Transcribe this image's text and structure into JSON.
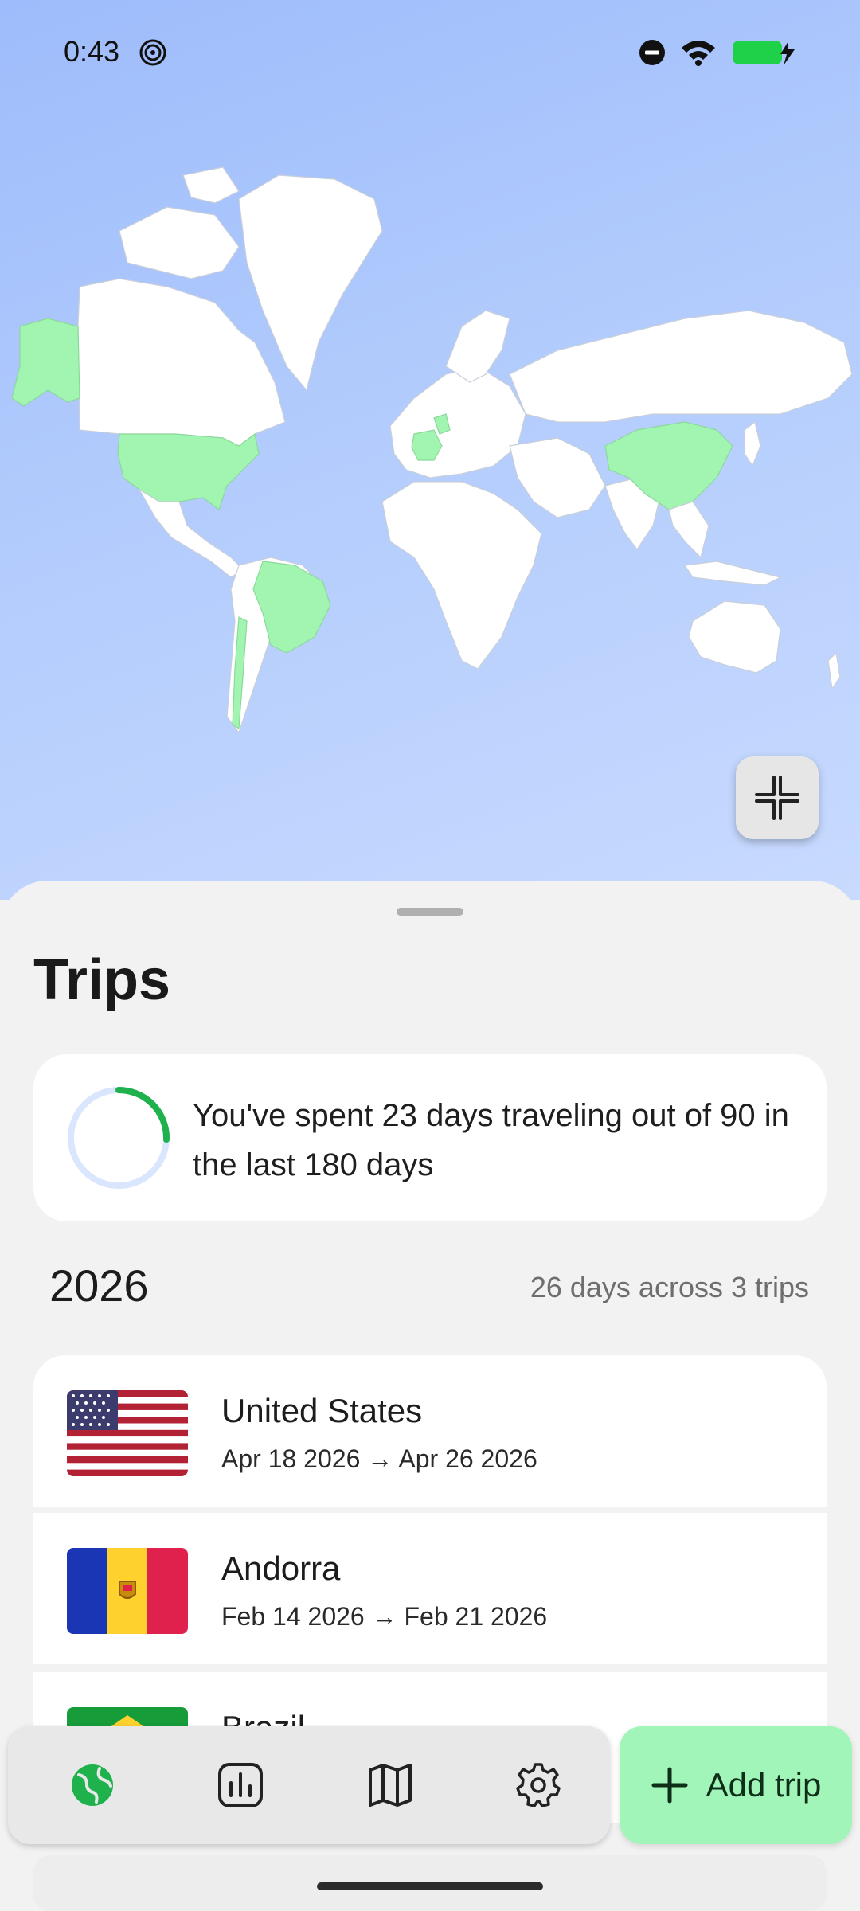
{
  "status_bar": {
    "time": "0:43",
    "left_icon": "spiral-notification-icon",
    "right_icons": [
      "do-not-disturb-icon",
      "wifi-icon",
      "battery-charging-icon"
    ]
  },
  "map": {
    "visited_color": "#a1f5b0",
    "land_color": "#ffffff",
    "ocean_color": "#a9c4fc",
    "collapse_icon": "collapse-icon"
  },
  "sheet": {
    "title": "Trips",
    "summary": {
      "text": "You've spent 23 days traveling out of 90 in the last 180 days",
      "days_spent": 23,
      "days_allowed": 90,
      "progress_fraction": 0.2556
    },
    "year_group": {
      "year": "2026",
      "stats": "26 days across 3 trips"
    },
    "trips": [
      {
        "country": "United States",
        "start": "Apr 18 2026",
        "end": "Apr 26 2026",
        "flag_icon": "us-flag-icon"
      },
      {
        "country": "Andorra",
        "start": "Feb 14 2026",
        "end": "Feb 21 2026",
        "flag_icon": "andorra-flag-icon"
      },
      {
        "country": "Brazil",
        "start": "",
        "end": "",
        "flag_icon": "brazil-flag-icon"
      }
    ],
    "date_arrow": "→"
  },
  "bottom_nav": {
    "items": [
      {
        "name": "globe",
        "icon": "globe-icon",
        "active": true
      },
      {
        "name": "stats",
        "icon": "bar-chart-icon",
        "active": false
      },
      {
        "name": "map",
        "icon": "map-icon",
        "active": false
      },
      {
        "name": "settings",
        "icon": "gear-icon",
        "active": false
      }
    ],
    "add_trip_label": "Add trip",
    "add_icon": "plus-icon"
  },
  "colors": {
    "accent_green": "#1fb14b",
    "add_button": "#a1f5b8",
    "ring_track": "#d9e6fd"
  }
}
